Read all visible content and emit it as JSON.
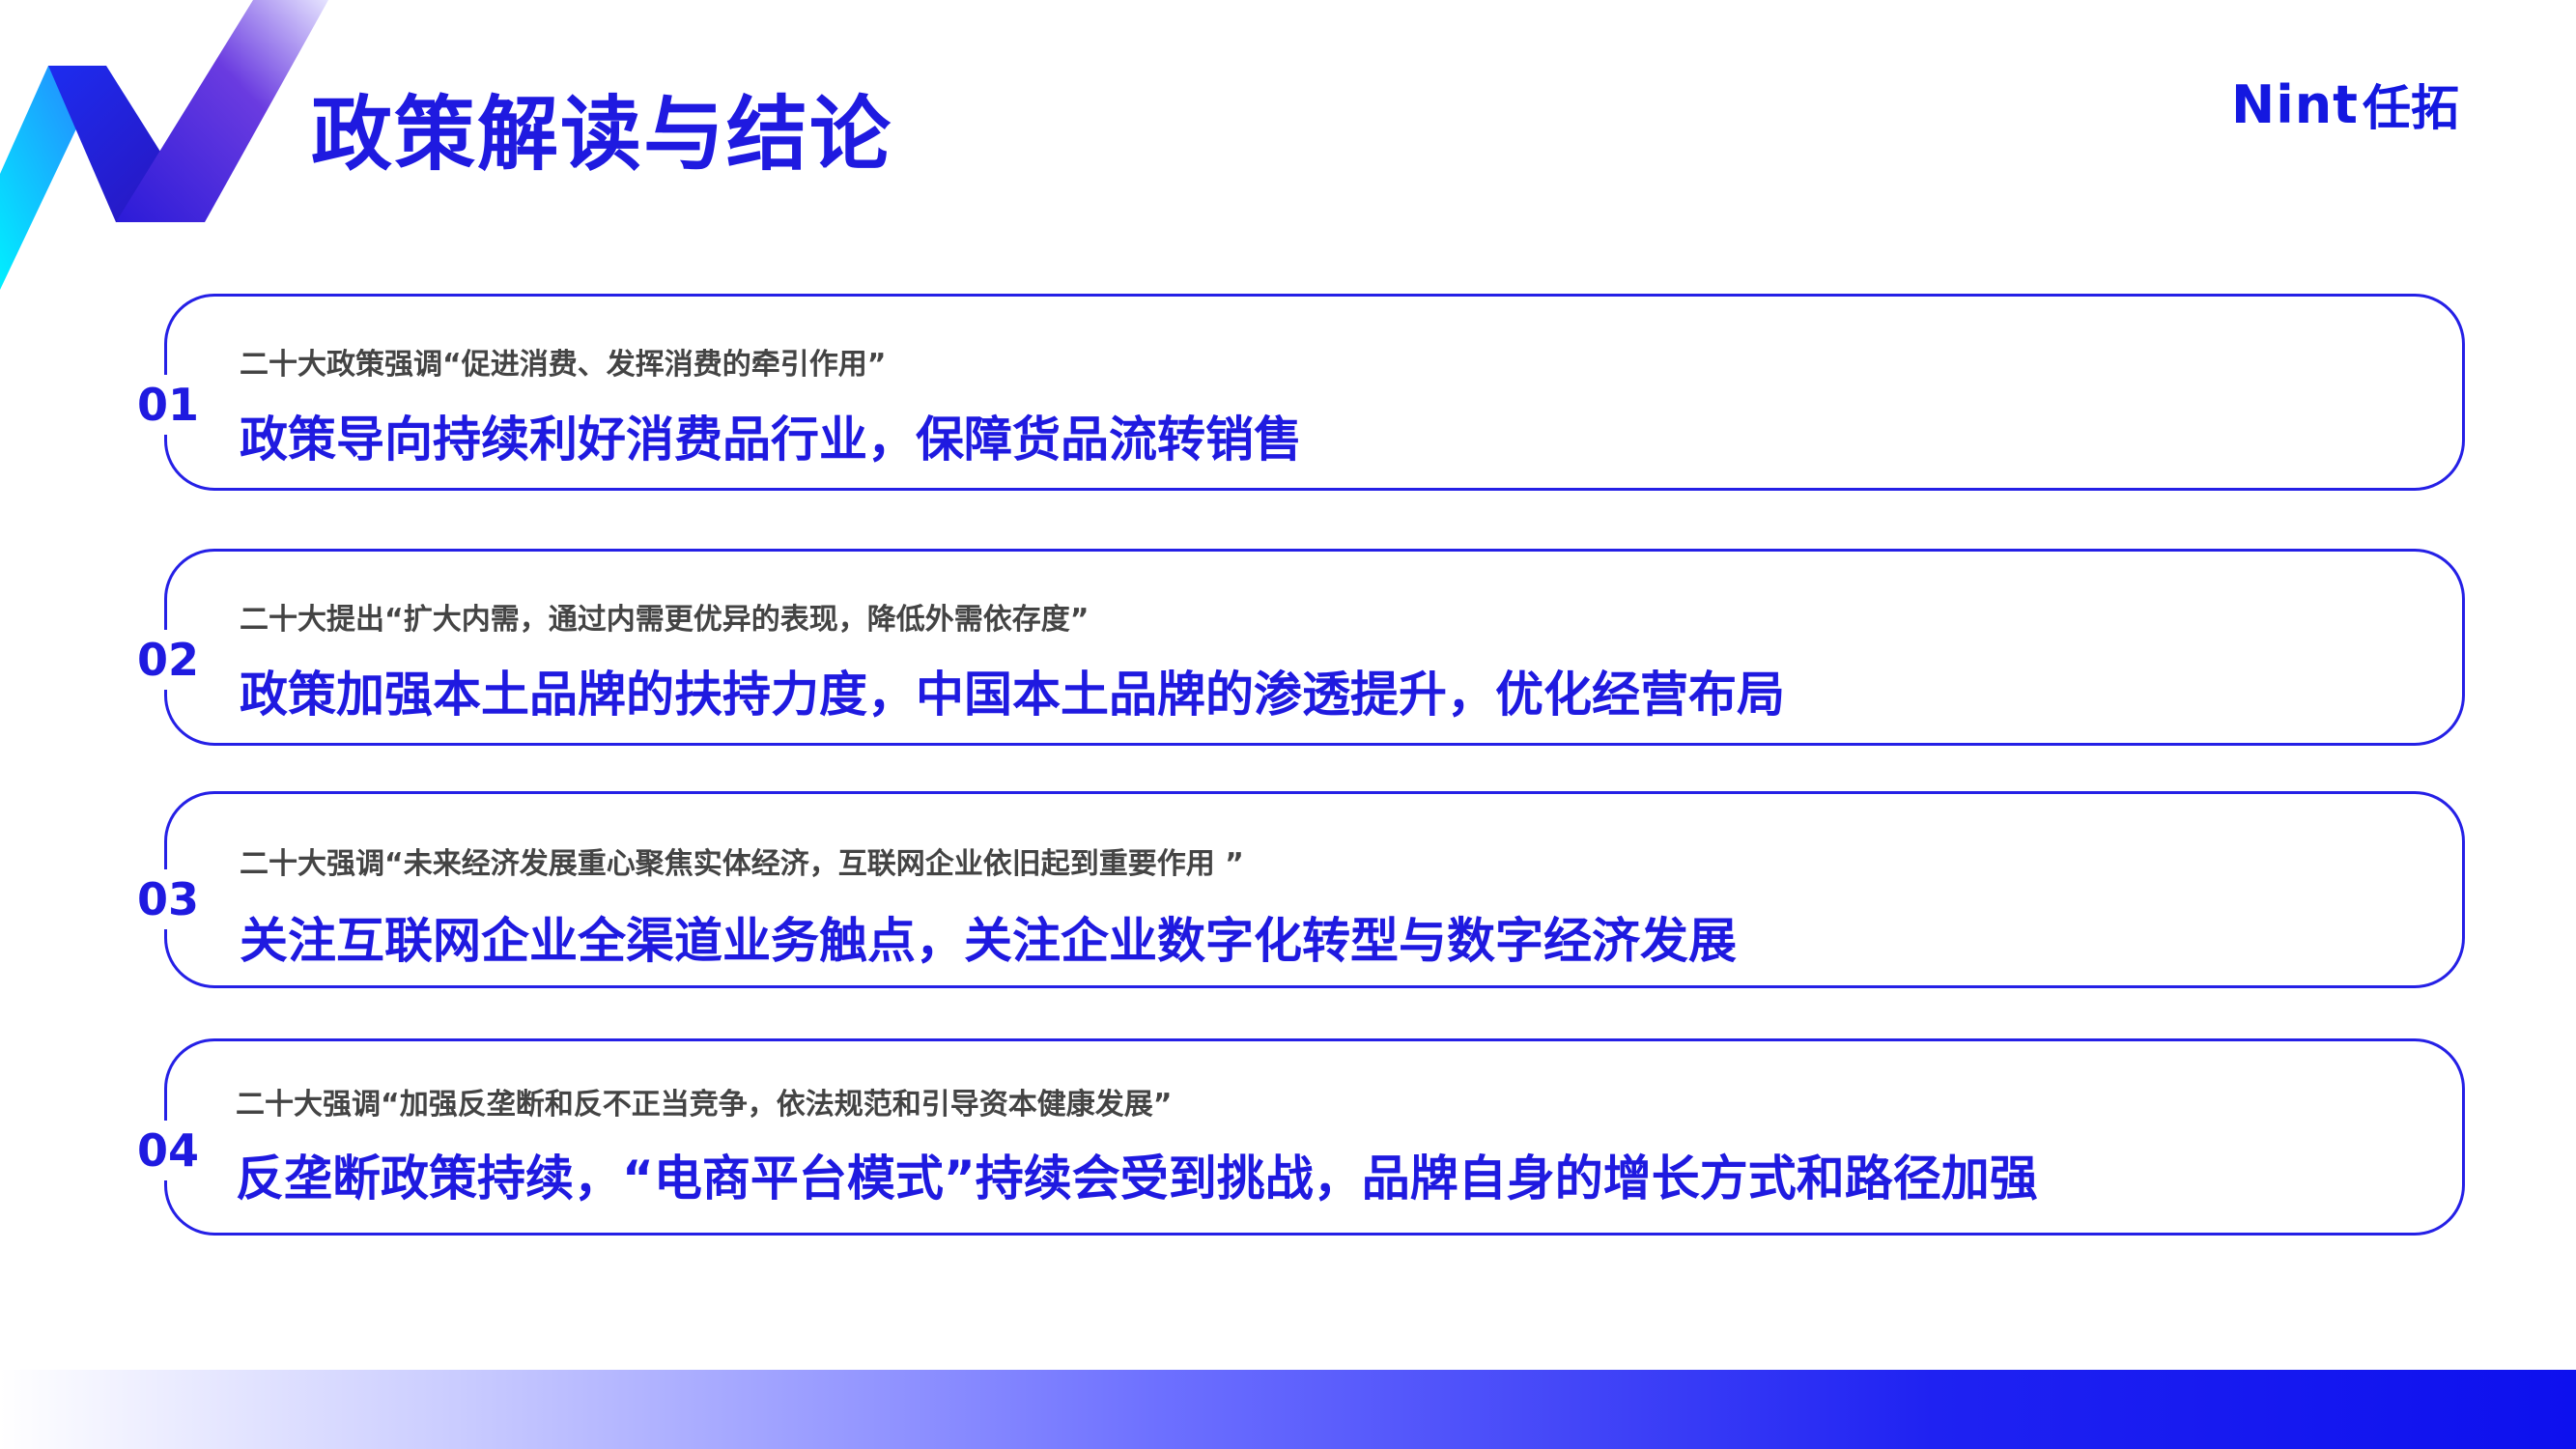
{
  "page": {
    "title": "政策解读与结论"
  },
  "brand": {
    "latin": "Nint",
    "cjk": "任拓"
  },
  "colors": {
    "accent": "#1f1ae0",
    "sub_text": "#444444",
    "logo_cyan": "#00e5ff",
    "logo_purple": "#5a2dd6"
  },
  "items": [
    {
      "number": "01",
      "subtitle": "二十大政策强调“促进消费、发挥消费的牵引作用”",
      "main": "政策导向持续利好消费品行业，保障货品流转销售"
    },
    {
      "number": "02",
      "subtitle": "二十大提出“扩大内需，通过内需更优异的表现，降低外需依存度”",
      "main": "政策加强本土品牌的扶持力度，中国本土品牌的渗透提升，优化经营布局"
    },
    {
      "number": "03",
      "subtitle": "二十大强调“未来经济发展重心聚焦实体经济，互联网企业依旧起到重要作用 ”",
      "main": "关注互联网企业全渠道业务触点，关注企业数字化转型与数字经济发展"
    },
    {
      "number": "04",
      "subtitle": "二十大强调“加强反垄断和反不正当竞争，依法规范和引导资本健康发展”",
      "main": "反垄断政策持续，“电商平台模式”持续会受到挑战，品牌自身的增长方式和路径加强"
    }
  ]
}
